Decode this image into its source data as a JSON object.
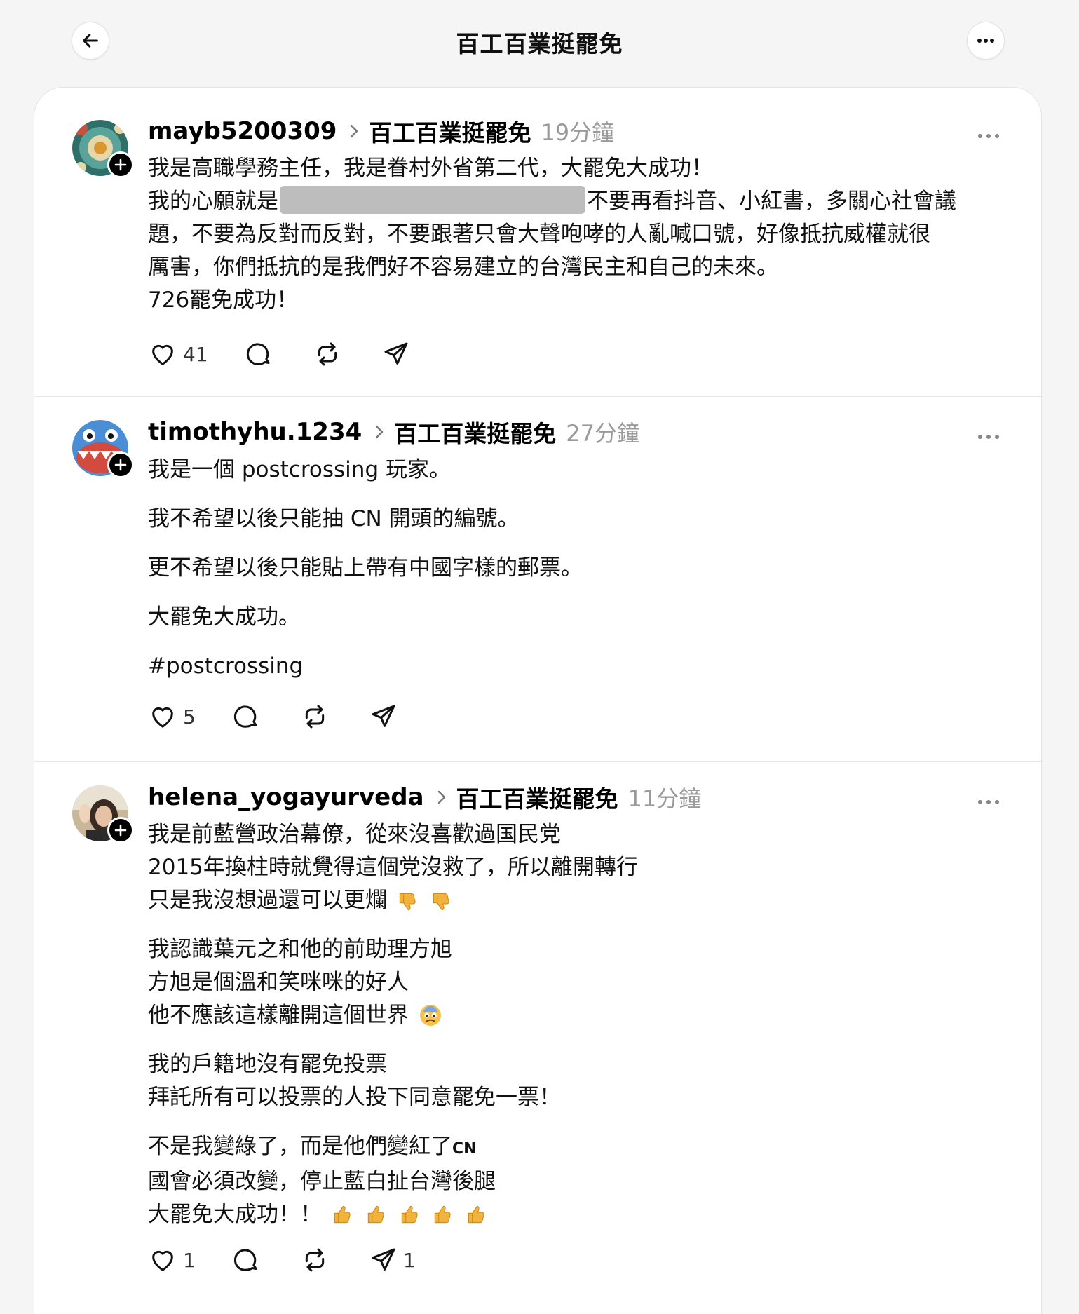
{
  "header": {
    "title": "百工百業挺罷免"
  },
  "posts": [
    {
      "username": "mayb5200309",
      "topic": "百工百業挺罷免",
      "time": "19分鐘",
      "paragraphs": [
        [
          "我是高職學務主任，我是眷村外省第二代，大罷免大成功！"
        ]
      ],
      "line2_pre": "我的心願就是",
      "line2_post": "不要再看抖音、小紅書，多關心社會議",
      "line3": "題，不要為反對而反對，不要跟著只會大聲咆哮的人亂喊口號，好像抵抗威權就很",
      "line4": "厲害，你們抵抗的是我們好不容易建立的台灣民主和自己的未來。",
      "line5": "726罷免成功！",
      "likes": "41"
    },
    {
      "username": "timothyhu.1234",
      "topic": "百工百業挺罷免",
      "time": "27分鐘",
      "paragraphs": [
        "我是一個 postcrossing 玩家。",
        "我不希望以後只能抽 CN 開頭的編號。",
        "更不希望以後只能貼上帶有中國字樣的郵票。",
        "大罷免大成功。",
        "#postcrossing"
      ],
      "likes": "5"
    },
    {
      "username": "helena_yogayurveda",
      "topic": "百工百業挺罷免",
      "time": "11分鐘",
      "p1": [
        "我是前藍營政治幕僚，從來沒喜歡過国民党",
        "2015年換柱時就覺得這個党沒救了，所以離開轉行",
        "只是我沒想過還可以更爛"
      ],
      "p2": [
        "我認識葉元之和他的前助理方旭",
        "方旭是個溫和笑咪咪的好人",
        "他不應該這樣離開這個世界"
      ],
      "p3": [
        "我的戶籍地沒有罷免投票",
        "拜託所有可以投票的人投下同意罷免一票！"
      ],
      "p4_line1": "不是我變綠了，而是他們變紅了",
      "p4_cn": "CN",
      "p4_line2": "國會必須改變，停止藍白扯台灣後腿",
      "p4_line3": "大罷免大成功！！",
      "likes": "1",
      "shares": "1"
    }
  ]
}
